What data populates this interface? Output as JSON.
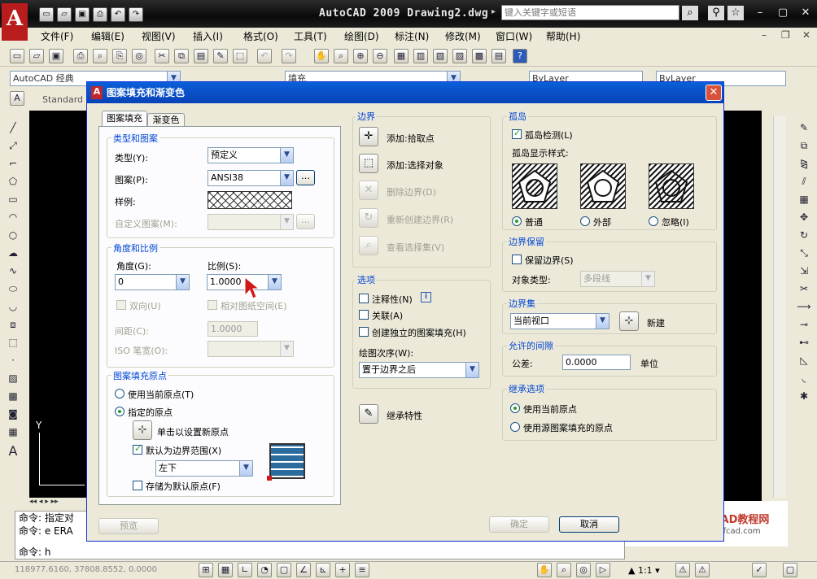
{
  "app": {
    "title": "AutoCAD 2009 Drawing2.dwg",
    "search_placeholder": "键入关键字或短语",
    "menus": [
      "文件(F)",
      "编辑(E)",
      "视图(V)",
      "插入(I)",
      "格式(O)",
      "工具(T)",
      "绘图(D)",
      "标注(N)",
      "修改(M)",
      "窗口(W)",
      "帮助(H)"
    ],
    "workspace": "AutoCAD 经典",
    "layer": "填充",
    "bylayer1": "ByLayer",
    "bylayer2": "ByLayer",
    "textstyle": "Standard",
    "command_lines": [
      "命令: 指定对",
      "命令: e ERA",
      "命令: h"
    ],
    "coords": "118977.6160, 37808.8552, 0.0000",
    "scale": "1:1",
    "watermark": "我爱CAD教程网",
    "watermark_url": "www.mfcad.com",
    "axis_y": "Y"
  },
  "dialog": {
    "title": "图案填充和渐变色",
    "tabs": [
      "图案填充",
      "渐变色"
    ],
    "type_pattern": {
      "group": "类型和图案",
      "type_label": "类型(Y):",
      "type_value": "预定义",
      "pattern_label": "图案(P):",
      "pattern_value": "ANSI38",
      "swatch_label": "样例:",
      "custom_label": "自定义图案(M):"
    },
    "angle_scale": {
      "group": "角度和比例",
      "angle_label": "角度(G):",
      "angle_value": "0",
      "scale_label": "比例(S):",
      "scale_value": "1.0000",
      "double_label": "双向(U)",
      "relative_label": "相对图纸空间(E)",
      "spacing_label": "间距(C):",
      "spacing_value": "1.0000",
      "iso_label": "ISO 笔宽(O):"
    },
    "origin": {
      "group": "图案填充原点",
      "use_current": "使用当前原点(T)",
      "specified": "指定的原点",
      "click_set": "单击以设置新原点",
      "default_boundary": "默认为边界范围(X)",
      "position": "左下",
      "store_default": "存储为默认原点(F)"
    },
    "boundary": {
      "group": "边界",
      "add_pick": "添加:拾取点",
      "add_select": "添加:选择对象",
      "remove": "删除边界(D)",
      "recreate": "重新创建边界(R)",
      "view_sel": "查看选择集(V)"
    },
    "options": {
      "group": "选项",
      "annotative": "注释性(N)",
      "associative": "关联(A)",
      "separate": "创建独立的图案填充(H)",
      "draw_order_label": "绘图次序(W):",
      "draw_order_value": "置于边界之后"
    },
    "inherit": "继承特性",
    "islands": {
      "group": "孤岛",
      "detect": "孤岛检测(L)",
      "style_label": "孤岛显示样式:",
      "normal": "普通",
      "outer": "外部",
      "ignore": "忽略(I)"
    },
    "retain": {
      "group": "边界保留",
      "keep": "保留边界(S)",
      "obj_type_label": "对象类型:",
      "obj_type_value": "多段线"
    },
    "boundary_set": {
      "group": "边界集",
      "value": "当前视口",
      "new": "新建"
    },
    "gap": {
      "group": "允许的间隙",
      "tol_label": "公差:",
      "tol_value": "0.0000",
      "unit": "单位"
    },
    "inherit_opts": {
      "group": "继承选项",
      "use_current": "使用当前原点",
      "use_source": "使用源图案填充的原点"
    },
    "buttons": {
      "preview": "预览",
      "ok": "确定",
      "cancel": "取消"
    }
  },
  "colors": {
    "accent": "#0046d5",
    "title_blue": "#0a5fd8",
    "close_red": "#d8513a"
  }
}
